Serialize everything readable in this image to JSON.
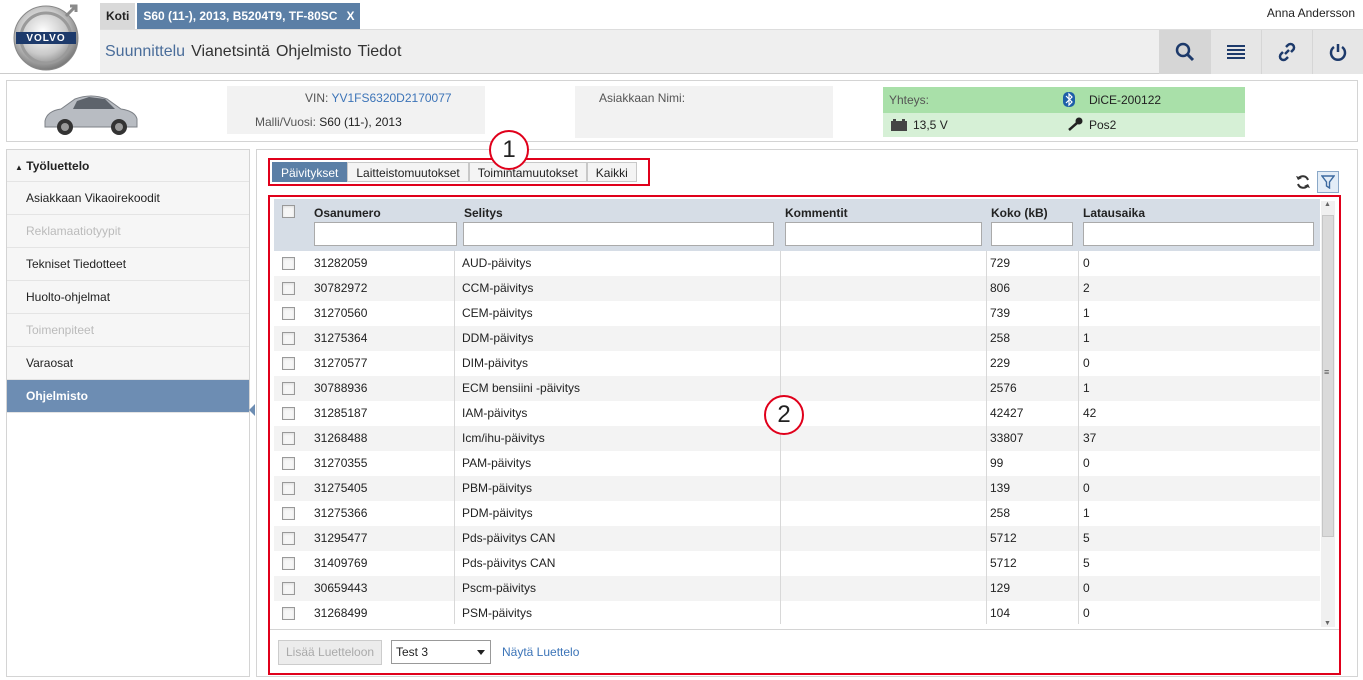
{
  "header": {
    "tabs": [
      {
        "label": "Koti"
      },
      {
        "label": "S60 (11-), 2013, B5204T9, TF-80SC",
        "close": "X"
      }
    ],
    "user": "Anna Andersson",
    "nav": [
      "Suunnittelu",
      "Vianetsintä",
      "Ohjelmisto",
      "Tiedot"
    ],
    "logo_text": "VOLVO",
    "buttons": [
      "search-icon",
      "list-icon",
      "link-icon",
      "power-icon"
    ]
  },
  "vehicle": {
    "vin_label": "VIN:",
    "vin": "YV1FS6320D2170077",
    "model_label": "Malli/Vuosi:",
    "model": "S60 (11-), 2013",
    "customer_label": "Asiakkaan Nimi:",
    "customer": "",
    "connection_label": "Yhteys:",
    "device": "DiCE-200122",
    "voltage": "13,5 V",
    "position": "Pos2"
  },
  "sidebar": {
    "title": "Työluettelo",
    "items": [
      {
        "label": "Asiakkaan Vikaoirekoodit",
        "state": "normal"
      },
      {
        "label": "Reklamaatiotyypit",
        "state": "disabled"
      },
      {
        "label": "Tekniset Tiedotteet",
        "state": "normal"
      },
      {
        "label": "Huolto-ohjelmat",
        "state": "normal"
      },
      {
        "label": "Toimenpiteet",
        "state": "disabled"
      },
      {
        "label": "Varaosat",
        "state": "normal"
      },
      {
        "label": "Ohjelmisto",
        "state": "active"
      }
    ]
  },
  "main": {
    "subtabs": [
      "Päivitykset",
      "Laitteistomuutokset",
      "Toimintamuutokset",
      "Kaikki"
    ],
    "callout1": "1",
    "callout2": "2",
    "columns": [
      "Osanumero",
      "Selitys",
      "Kommentit",
      "Koko (kB)",
      "Latausaika"
    ],
    "rows": [
      {
        "part": "31282059",
        "desc": "AUD-päivitys",
        "comment": "",
        "size": "729",
        "time": "0"
      },
      {
        "part": "30782972",
        "desc": "CCM-päivitys",
        "comment": "",
        "size": "806",
        "time": "2"
      },
      {
        "part": "31270560",
        "desc": "CEM-päivitys",
        "comment": "",
        "size": "739",
        "time": "1"
      },
      {
        "part": "31275364",
        "desc": "DDM-päivitys",
        "comment": "",
        "size": "258",
        "time": "1"
      },
      {
        "part": "31270577",
        "desc": "DIM-päivitys",
        "comment": "",
        "size": "229",
        "time": "0"
      },
      {
        "part": "30788936",
        "desc": "ECM bensiini -päivitys",
        "comment": "",
        "size": "2576",
        "time": "1"
      },
      {
        "part": "31285187",
        "desc": "IAM-päivitys",
        "comment": "",
        "size": "42427",
        "time": "42"
      },
      {
        "part": "31268488",
        "desc": "Icm/ihu-päivitys",
        "comment": "",
        "size": "33807",
        "time": "37"
      },
      {
        "part": "31270355",
        "desc": "PAM-päivitys",
        "comment": "",
        "size": "99",
        "time": "0"
      },
      {
        "part": "31275405",
        "desc": "PBM-päivitys",
        "comment": "",
        "size": "139",
        "time": "0"
      },
      {
        "part": "31275366",
        "desc": "PDM-päivitys",
        "comment": "",
        "size": "258",
        "time": "1"
      },
      {
        "part": "31295477",
        "desc": "Pds-päivitys CAN",
        "comment": "",
        "size": "5712",
        "time": "5"
      },
      {
        "part": "31409769",
        "desc": "Pds-päivitys CAN",
        "comment": "",
        "size": "5712",
        "time": "5"
      },
      {
        "part": "30659443",
        "desc": "Pscm-päivitys",
        "comment": "",
        "size": "129",
        "time": "0"
      },
      {
        "part": "31268499",
        "desc": "PSM-päivitys",
        "comment": "",
        "size": "104",
        "time": "0"
      }
    ],
    "footer": {
      "add_label": "Lisää Luetteloon",
      "select_value": "Test 3",
      "show_link": "Näytä Luettelo"
    }
  },
  "colors": {
    "accent": "#5b7fa6",
    "highlight": "#e0001b",
    "connection_green": "#a9e0a9"
  }
}
